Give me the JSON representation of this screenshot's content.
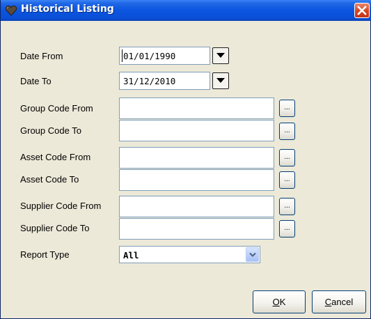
{
  "window": {
    "title": "Historical Listing"
  },
  "form": {
    "date_from": {
      "label": "Date From",
      "value": "01/01/1990"
    },
    "date_to": {
      "label": "Date To",
      "value": "31/12/2010"
    },
    "group_code_from": {
      "label": "Group Code From",
      "value": ""
    },
    "group_code_to": {
      "label": "Group Code To",
      "value": ""
    },
    "asset_code_from": {
      "label": "Asset Code From",
      "value": ""
    },
    "asset_code_to": {
      "label": "Asset Code To",
      "value": ""
    },
    "supplier_code_from": {
      "label": "Supplier Code From",
      "value": ""
    },
    "supplier_code_to": {
      "label": "Supplier Code To",
      "value": ""
    },
    "report_type": {
      "label": "Report Type",
      "value": "All"
    },
    "browse_label": "..."
  },
  "buttons": {
    "ok_mnemonic": "O",
    "ok_rest": "K",
    "cancel_mnemonic": "C",
    "cancel_rest": "ancel"
  },
  "icons": {
    "title_icon": "heart-icon",
    "close": "close-icon",
    "dropdown": "triangle-down-icon",
    "select": "chevron-down-icon"
  },
  "colors": {
    "titlebar": "#0b55e0",
    "close": "#d8421e",
    "dialog_bg": "#ece9d8",
    "field_border": "#7f9db9"
  }
}
